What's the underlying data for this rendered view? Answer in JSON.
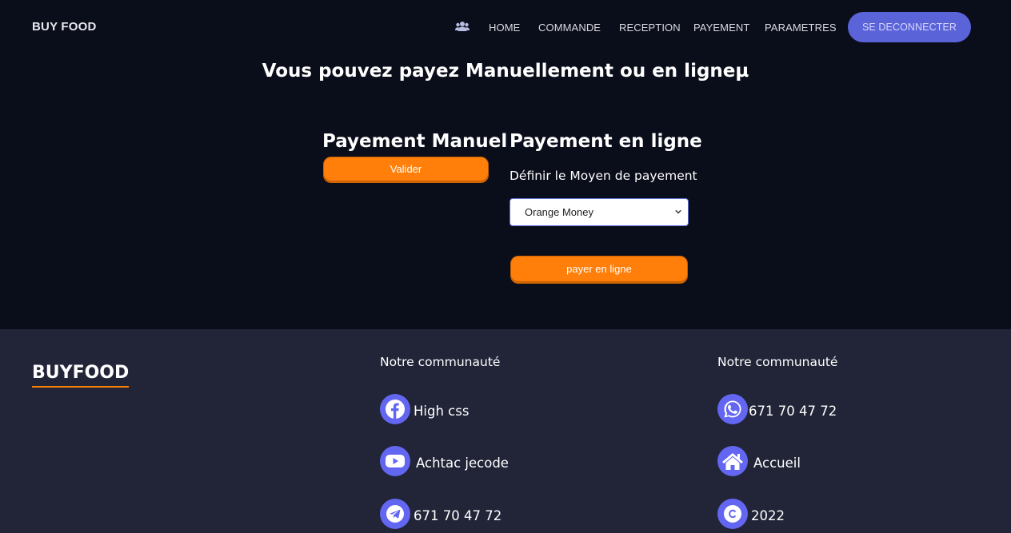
{
  "nav": {
    "brand": "BUY FOOD",
    "users_icon": "users-icon",
    "links": [
      "HOME",
      "COMMANDE",
      "RECEPTION",
      "PAYEMENT",
      "PARAMETRES"
    ],
    "logout": "SE DECONNECTER"
  },
  "main": {
    "title": "Vous pouvez payez Manuellement ou en ligneµ",
    "manual": {
      "title": "Payement Manuel",
      "button": "Valider"
    },
    "online": {
      "title": "Payement en ligne",
      "label": "Définir le Moyen de payement",
      "select_value": "Orange Money",
      "button": "payer en ligne"
    }
  },
  "footer": {
    "brand": "BUYFOOD",
    "col1": {
      "heading": "Notre communauté",
      "items": [
        {
          "icon": "facebook-icon",
          "text": "High css"
        },
        {
          "icon": "youtube-icon",
          "text": "Achtac jecode"
        },
        {
          "icon": "telegram-icon",
          "text": "671 70 47 72"
        }
      ]
    },
    "col2": {
      "heading": "Notre communauté",
      "items": [
        {
          "icon": "whatsapp-icon",
          "text": "671 70 47 72"
        },
        {
          "icon": "home-icon",
          "text": "Accueil"
        },
        {
          "icon": "copyright-icon",
          "text": "2022"
        }
      ]
    }
  },
  "colors": {
    "background": "#0a0d1a",
    "footer": "#222538",
    "accent_orange": "#ff7f0a",
    "accent_purple": "#5b63d9"
  }
}
